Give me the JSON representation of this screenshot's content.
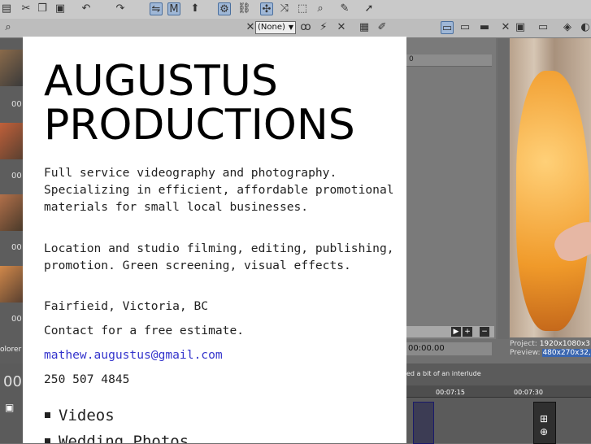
{
  "timeline": {
    "clip_label": "ed a bit of an interlude",
    "ruler_left": "00:07:15",
    "ruler_right": "00:07:30",
    "big_time": "00"
  },
  "trimmer": {
    "time_value": "00:00.00",
    "header_zero": "0"
  },
  "left_panel": {
    "thumb_label": "00",
    "explorer_tab": "olorer"
  },
  "toolbar": {
    "preset_select": "(None)"
  },
  "preview": {
    "project_label": "Project:",
    "project_value": "1920x1080x3",
    "preview_label": "Preview:",
    "preview_value": "480x270x32,"
  },
  "card": {
    "title_line1": "AUGUSTUS",
    "title_line2": "PRODUCTIONS",
    "paragraph1": "Full service videography and photography. Specializing in efficient, affordable promotional materials for small local businesses.",
    "paragraph2": "Location and studio filming, editing, publishing, promotion. Green screening, visual effects.",
    "location": "Fairfieid, Victoria, BC",
    "cta": "Contact for a free estimate.",
    "email": "mathew.augustus@gmail.com",
    "phone": "250 507 4845",
    "nav": [
      "Videos",
      "Wedding Photos"
    ]
  },
  "colors": {
    "link": "#3434cc",
    "text": "#222222",
    "selection": "#3a66b0"
  }
}
